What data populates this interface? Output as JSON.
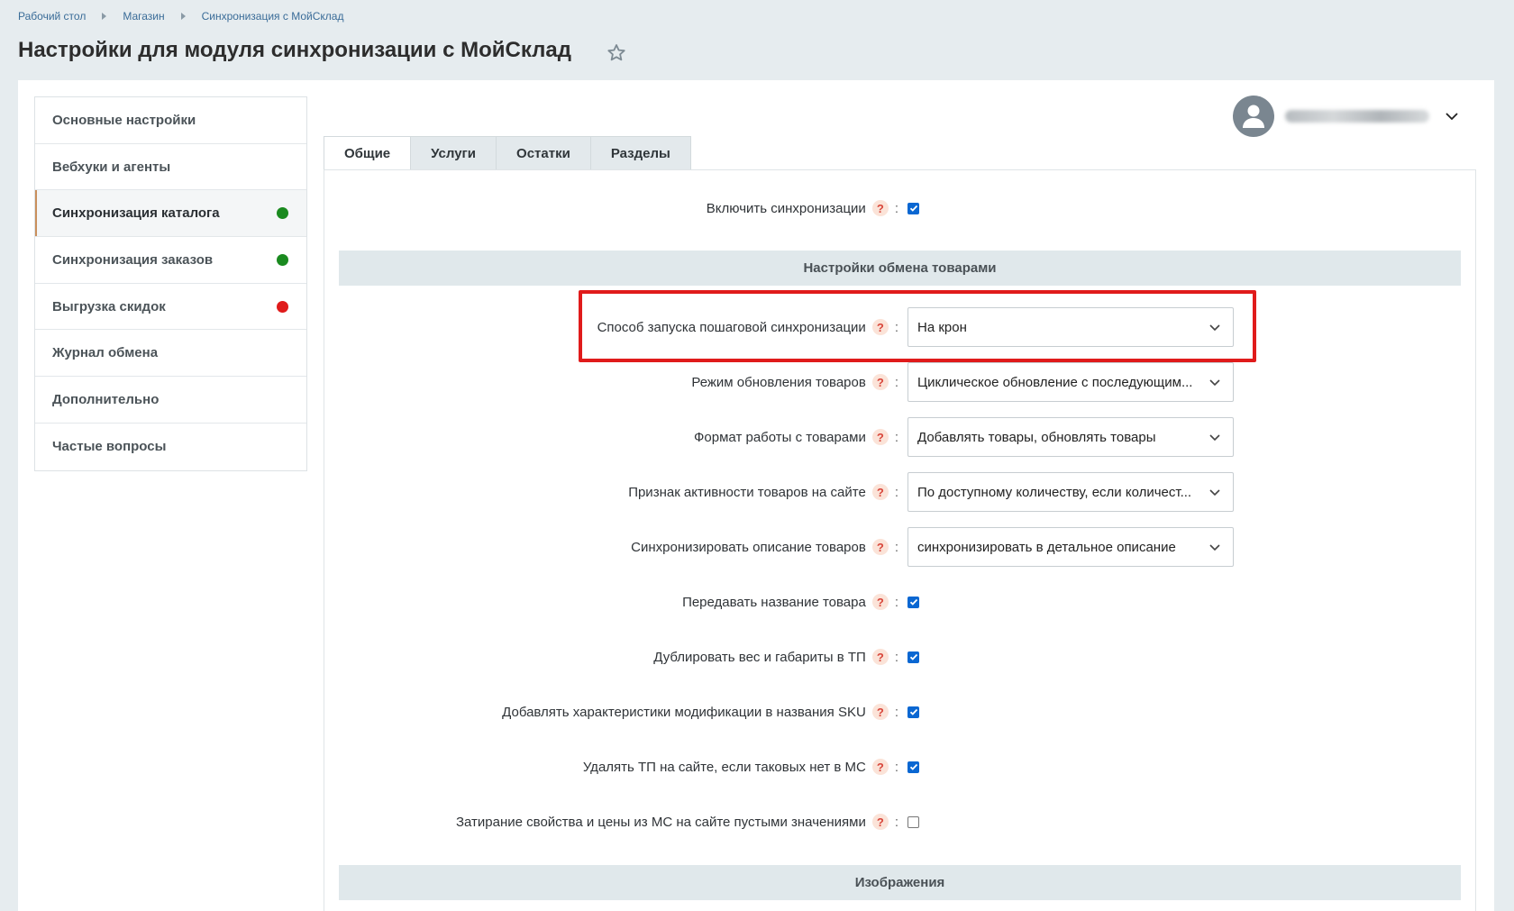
{
  "breadcrumb": [
    "Рабочий стол",
    "Магазин",
    "Синхронизация с МойСклад"
  ],
  "page_title": "Настройки для модуля синхронизации с МойСклад",
  "sidebar": {
    "items": [
      {
        "label": "Основные настройки",
        "status": null
      },
      {
        "label": "Вебхуки и агенты",
        "status": null
      },
      {
        "label": "Синхронизация каталога",
        "status": "#1a8a1f",
        "active": true
      },
      {
        "label": "Синхронизация заказов",
        "status": "#1a8a1f"
      },
      {
        "label": "Выгрузка скидок",
        "status": "#e01b1b"
      },
      {
        "label": "Журнал обмена",
        "status": null
      },
      {
        "label": "Дополнительно",
        "status": null
      },
      {
        "label": "Частые вопросы",
        "status": null
      }
    ]
  },
  "tabs": [
    "Общие",
    "Услуги",
    "Остатки",
    "Разделы"
  ],
  "help_glyph": "?",
  "colon": ":",
  "enable_sync": {
    "label": "Включить синхронизации",
    "checked": true
  },
  "section_goods": "Настройки обмена товарами",
  "section_images": "Изображения",
  "settings": {
    "launch_mode": {
      "label": "Способ запуска пошаговой синхронизации",
      "value": "На крон"
    },
    "update_mode": {
      "label": "Режим обновления товаров",
      "value": "Циклическое обновление с последующим..."
    },
    "work_format": {
      "label": "Формат работы с товарами",
      "value": "Добавлять товары, обновлять товары"
    },
    "activity_sign": {
      "label": "Признак активности товаров на сайте",
      "value": "По доступному количеству, если количест..."
    },
    "sync_description": {
      "label": "Синхронизировать описание товаров",
      "value": "синхронизировать в детальное описание"
    },
    "pass_name": {
      "label": "Передавать название товара",
      "checked": true
    },
    "dup_weight": {
      "label": "Дублировать вес и габариты в ТП",
      "checked": true
    },
    "add_mod_chars": {
      "label": "Добавлять характеристики модификации в названия SKU",
      "checked": true
    },
    "delete_tp": {
      "label": "Удалять ТП на сайте, если таковых нет в МС",
      "checked": true
    },
    "overwrite_empty": {
      "label": "Затирание свойства и цены из МС на сайте пустыми значениями",
      "checked": false
    }
  },
  "colors": {
    "accent": "#0a67d2",
    "highlight": "#e01b1b",
    "help": "#d8463a"
  }
}
